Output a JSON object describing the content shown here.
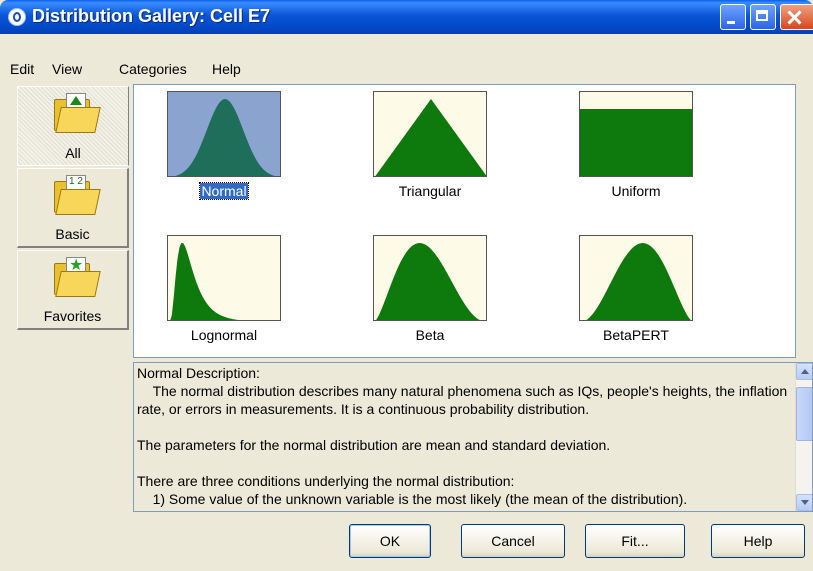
{
  "window": {
    "title": "Distribution Gallery: Cell E7"
  },
  "menu": [
    "Edit",
    "View",
    "Categories",
    "Help"
  ],
  "categories": [
    {
      "label": "All",
      "icon": "folder-chart-icon",
      "selected": true
    },
    {
      "label": "Basic",
      "icon": "folder-numbers-icon",
      "selected": false
    },
    {
      "label": "Favorites",
      "icon": "folder-star-icon",
      "selected": false
    }
  ],
  "category_icon_text": {
    "basic": "1 2"
  },
  "distributions": [
    {
      "label": "Normal",
      "shape": "normal",
      "selected": true
    },
    {
      "label": "Triangular",
      "shape": "triangular",
      "selected": false
    },
    {
      "label": "Uniform",
      "shape": "uniform",
      "selected": false
    },
    {
      "label": "Lognormal",
      "shape": "lognormal",
      "selected": false
    },
    {
      "label": "Beta",
      "shape": "beta",
      "selected": false
    },
    {
      "label": "BetaPERT",
      "shape": "betapert",
      "selected": false
    }
  ],
  "description": {
    "heading": "Normal Description:",
    "paragraph1": "    The normal distribution describes many natural phenomena such as IQs, people's heights, the inflation rate, or errors in measurements. It is a continuous probability distribution.",
    "paragraph2": "The parameters for the normal distribution are mean and standard deviation.",
    "paragraph3": "There are three conditions underlying the normal distribution:",
    "paragraph4": "    1) Some value of the unknown variable is the most likely (the mean of the distribution)."
  },
  "buttons": {
    "ok": "OK",
    "cancel": "Cancel",
    "fit": "Fit...",
    "help": "Help"
  },
  "colors": {
    "curve_fill": "#0e7a0e",
    "selected_curve_fill": "#1f6e5a",
    "thumb_bg": "#fdfbe8",
    "thumb_selected_bg": "#8aa3cf",
    "selection": "#316ac5"
  }
}
